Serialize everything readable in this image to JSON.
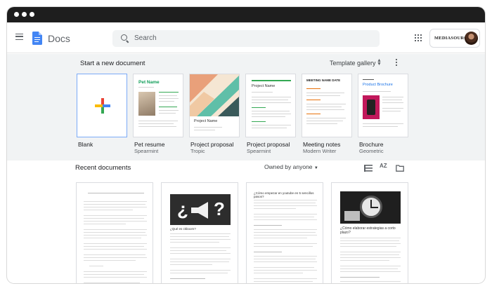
{
  "app": {
    "name": "Docs"
  },
  "search": {
    "placeholder": "Search"
  },
  "account": {
    "brand": "MEDIASOURCE"
  },
  "templates_section": {
    "title": "Start a new document",
    "gallery_label": "Template gallery",
    "items": [
      {
        "name": "Blank",
        "sub": ""
      },
      {
        "name": "Pet resume",
        "sub": "Spearmint",
        "thumb_title": "Pet Name"
      },
      {
        "name": "Project proposal",
        "sub": "Tropic",
        "thumb_title": "Project Name"
      },
      {
        "name": "Project proposal",
        "sub": "Spearmint",
        "thumb_title": "Project Name"
      },
      {
        "name": "Meeting notes",
        "sub": "Modern Writer",
        "thumb_title": "MEETING NAME DATE"
      },
      {
        "name": "Brochure",
        "sub": "Geometric",
        "thumb_title": "Product Brochure"
      }
    ]
  },
  "recent": {
    "title": "Recent documents",
    "owner_filter": "Owned by anyone",
    "sort_icon": "AZ",
    "docs": [
      {
        "heading": ""
      },
      {
        "heading": "¿Qué es ckboom?"
      },
      {
        "heading": "¿Cómo empezar en youtube en 5 sencillos pasos?"
      },
      {
        "heading": "¿Cómo elaborar estrategias a corto plazo?"
      }
    ]
  },
  "colors": {
    "accent": "#4285f4",
    "mint": "#34a853",
    "background": "#f1f3f4"
  }
}
